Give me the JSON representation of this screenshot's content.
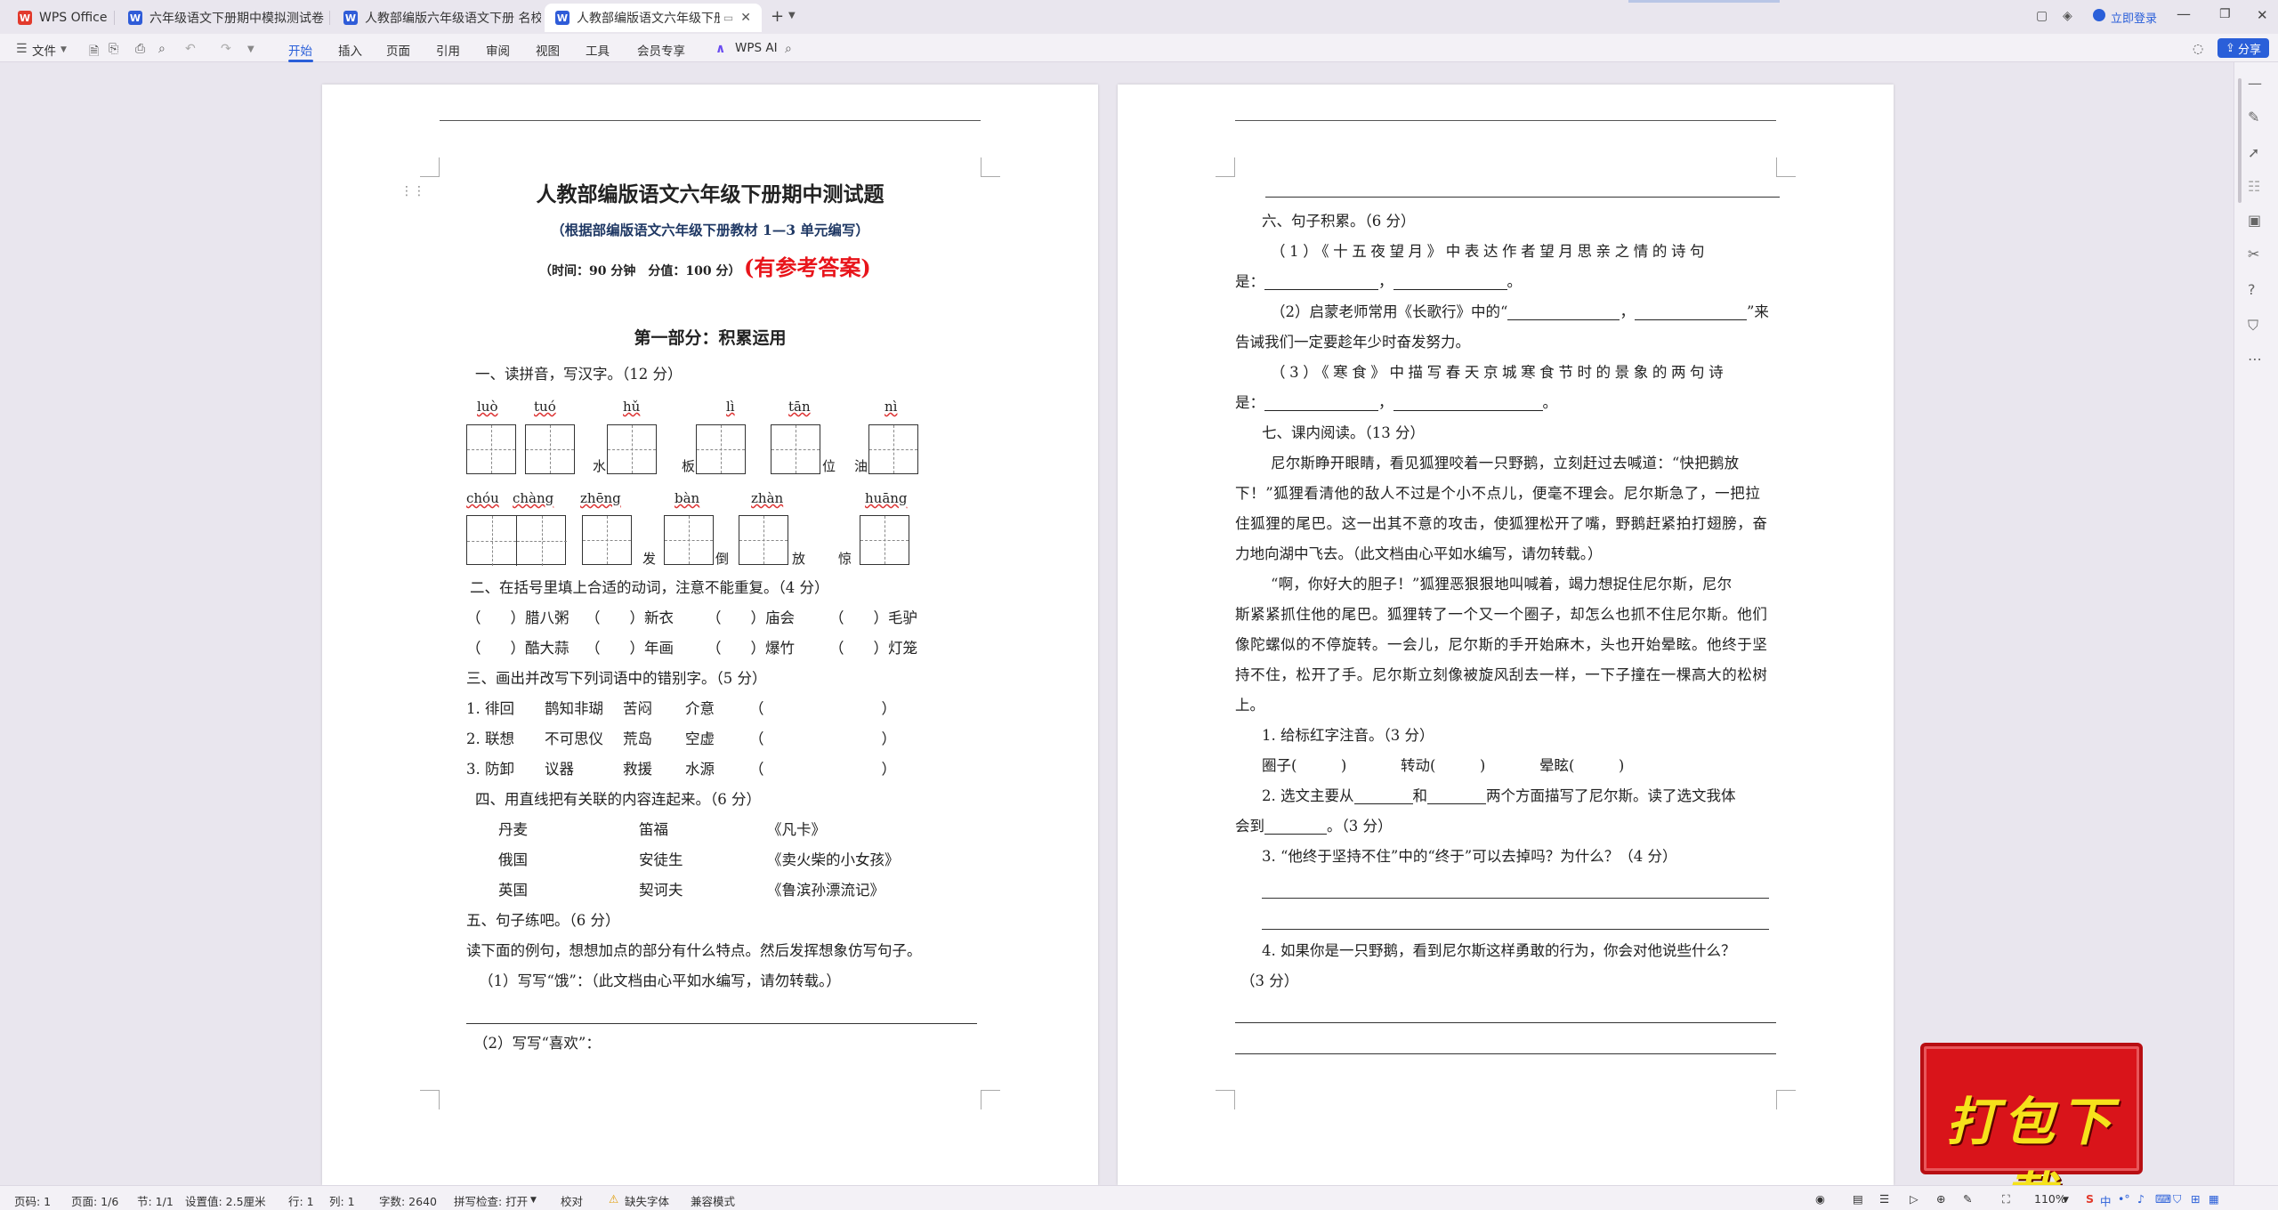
{
  "tabs": [
    {
      "label": "WPS Office"
    },
    {
      "label": "六年级语文下册期中模拟测试卷（六"
    },
    {
      "label": "人教部编版六年级语文下册 名校期中"
    },
    {
      "label": "人教部编版语文六年级下册期"
    }
  ],
  "titlebar": {
    "login": "立即登录"
  },
  "ribbon": {
    "file": "文件",
    "items": [
      "开始",
      "插入",
      "页面",
      "引用",
      "审阅",
      "视图",
      "工具",
      "会员专享"
    ],
    "wps_ai": "WPS AI",
    "share": "分享"
  },
  "page1": {
    "title": "人教部编版语文六年级下册期中测试题",
    "subtitle": "（根据部编版语文六年级下册教材 1—3 单元编写）",
    "time_info": "（时间：90 分钟　分值：100 分）",
    "answer_note": "(有参考答案)",
    "part1": "第一部分：积累运用",
    "q1": "一、读拼音，写汉字。（12 分）",
    "pinyin_row1": [
      "luò",
      "tuó",
      "hǔ",
      "lì",
      "tān",
      "nì"
    ],
    "suffix_row1": [
      "水",
      "板",
      "位",
      "油"
    ],
    "pinyin_row2": [
      "chóu",
      "chàng",
      "zhēng",
      "bàn",
      "zhàn",
      "huāng"
    ],
    "suffix_row2": [
      "发",
      "倒",
      "放",
      "惊"
    ],
    "q2": "二、在括号里填上合适的动词，注意不能重复。（4 分）",
    "q2_row1": [
      "（　　）腊八粥",
      "（　　）新衣",
      "（　　）庙会",
      "（　　）毛驴"
    ],
    "q2_row2": [
      "（　　）酷大蒜",
      "（　　）年画",
      "（　　）爆竹",
      "（　　）灯笼"
    ],
    "q3": "三、画出并改写下列词语中的错别字。（5 分）",
    "q3_rows": [
      [
        "1. 徘回",
        "鹊知非瑚",
        "苦闷",
        "介意",
        "（　　　　　　　　）"
      ],
      [
        "2. 联想",
        "不可思仪",
        "荒岛",
        "空虚",
        "（　　　　　　　　）"
      ],
      [
        "3. 防卸",
        "议器",
        "救援",
        "水源",
        "（　　　　　　　　）"
      ]
    ],
    "q4": "四、用直线把有关联的内容连起来。（6 分）",
    "q4_rows": [
      [
        "丹麦",
        "笛福",
        "《凡卡》"
      ],
      [
        "俄国",
        "安徒生",
        "《卖火柴的小女孩》"
      ],
      [
        "英国",
        "契诃夫",
        "《鲁滨孙漂流记》"
      ]
    ],
    "q5": "五、句子练吧。（6 分）",
    "q5_intro": "读下面的例句，想想加点的部分有什么特点。然后发挥想象仿写句子。",
    "q5_1": "（1）写写“饿”：（此文档由心平如水编写，请勿转载。）",
    "q5_2": "（2）写写“喜欢”："
  },
  "page2": {
    "q6": "六、句子积累。（6 分）",
    "q6_1a": "（1）《十五夜望月》中表达作者望月思亲之情的诗句",
    "q6_1b": "是：",
    "q6_2a": "（2）启蒙老师常用《长歌行》中的“",
    "q6_2b": "”来",
    "q6_2c": "告诫我们一定要趁年少时奋发努力。",
    "q6_3a": "（3）《寒食》中描写春天京城寒食节时的景象的两句诗",
    "q6_3b": "是：",
    "q7": "七、课内阅读。（13 分）",
    "passage": [
      "尼尔斯睁开眼睛，看见狐狸咬着一只野鹅，立刻赶过去喊道：“快把鹅放",
      "下！”狐狸看清他的敌人不过是个小不点儿，便毫不理会。尼尔斯急了，一把拉",
      "住狐狸的尾巴。这一出其不意的攻击，使狐狸松开了嘴，野鹅赶紧拍打翅膀，奋",
      "力地向湖中飞去。（此文档由心平如水编写，请勿转载。）",
      "“啊，你好大的胆子！”狐狸恶狠狠地叫喊着，竭力想捉住尼尔斯，尼尔",
      "斯紧紧抓住他的尾巴。狐狸转了一个又一个圈子，却怎么也抓不住尼尔斯。他们",
      "像陀螺似的不停旋转。一会儿，尼尔斯的手开始麻木，头也开始晕眩。他终于坚",
      "持不住，松开了手。尼尔斯立刻像被旋风刮去一样，一下子撞在一棵高大的松树",
      "上。"
    ],
    "sq1": "1. 给标红字注音。（3 分）",
    "sq1_items": [
      "圈子(　　　)",
      "转动(　　　)",
      "晕眩(　　　)"
    ],
    "sq2a": "2. 选文主要从",
    "sq2b": "和",
    "sq2c": "两个方面描写了尼尔斯。读了选文我体",
    "sq2d": "会到",
    "sq2e": "。（3 分）",
    "sq3": "3. “他终于坚持不住”中的“终于”可以去掉吗？为什么？（4 分）",
    "sq4": "4. 如果你是一只野鹅，看到尼尔斯这样勇敢的行为，你会对他说些什么？",
    "sq4b": "（3 分）"
  },
  "promo": {
    "text": "打包下载"
  },
  "status": {
    "page": "页码: 1",
    "pages": "页面: 1/6",
    "section": "节: 1/1",
    "setting": "设置值: 2.5厘米",
    "row": "行: 1",
    "col": "列: 1",
    "words": "字数: 2640",
    "spell": "拼写检查: 打开",
    "proof": "校对",
    "font_missing": "缺失字体",
    "compat": "兼容模式",
    "zoom": "110%"
  },
  "colors": {
    "accent": "#2a5fd9",
    "answer_red": "#e8141a",
    "subtitle_navy": "#1f3864",
    "promo_red": "#d9141a",
    "promo_yellow": "#f6e21b"
  }
}
